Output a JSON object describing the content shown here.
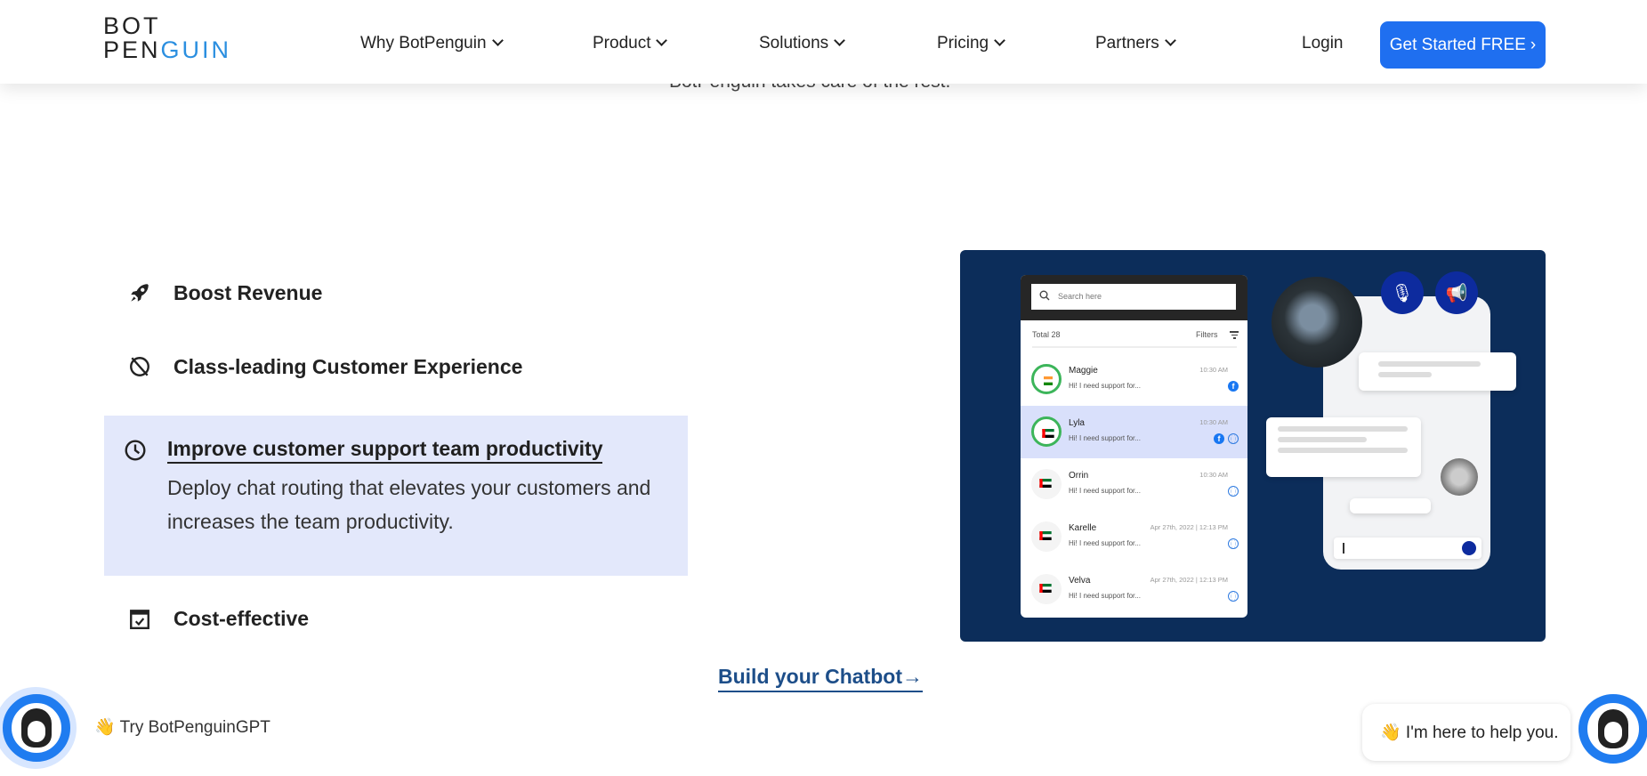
{
  "nav": {
    "logo_top": "BOT",
    "logo_bottom_a": "PEN",
    "logo_bottom_b": "GUIN",
    "items": [
      {
        "label": "Why BotPenguin"
      },
      {
        "label": "Product"
      },
      {
        "label": "Solutions"
      },
      {
        "label": "Pricing"
      },
      {
        "label": "Partners"
      }
    ],
    "login": "Login",
    "cta": "Get Started FREE"
  },
  "behind_text": "BotPenguin takes care of the rest.",
  "features": [
    {
      "title": "Boost Revenue",
      "icon": "rocket-icon"
    },
    {
      "title": "Class-leading Customer Experience",
      "icon": "no-compass-icon"
    },
    {
      "title": "Improve customer support team productivity",
      "icon": "clock-icon",
      "description": "Deploy chat routing that elevates your customers and increases the team productivity.",
      "active": true
    },
    {
      "title": "Cost-effective",
      "icon": "calendar-check-icon"
    }
  ],
  "mock": {
    "search_placeholder": "Search here",
    "total": "Total 28",
    "filters": "Filters",
    "rows": [
      {
        "name": "Maggie",
        "msg": "Hi! I need support for...",
        "time": "10:30 AM",
        "flag": "india",
        "channels": [
          "facebook"
        ],
        "online": true
      },
      {
        "name": "Lyla",
        "msg": "Hi! I need support for...",
        "time": "10:30 AM",
        "flag": "uae",
        "channels": [
          "facebook",
          "web"
        ],
        "online": true,
        "selected": true
      },
      {
        "name": "Orrin",
        "msg": "Hi! I need support for...",
        "time": "10:30 AM",
        "flag": "uae",
        "channels": [
          "web"
        ]
      },
      {
        "name": "Karelle",
        "msg": "Hi! I need support for...",
        "time": "Apr 27th, 2022 | 12:13 PM",
        "flag": "uae",
        "channels": [
          "web"
        ]
      },
      {
        "name": "Velva",
        "msg": "Hi! I need support for...",
        "time": "Apr 27th, 2022 | 12:13 PM",
        "flag": "uae",
        "channels": [
          "web"
        ]
      }
    ]
  },
  "build_link": "Build your Chatbot→",
  "try_gpt": "👋 Try BotPenguinGPT",
  "help_bubble": "👋 I'm here to help you.",
  "colors": {
    "accent": "#1f6ff0",
    "panel": "#0c2d5a",
    "highlight": "#e3e8fb",
    "link": "#1d4e89"
  }
}
